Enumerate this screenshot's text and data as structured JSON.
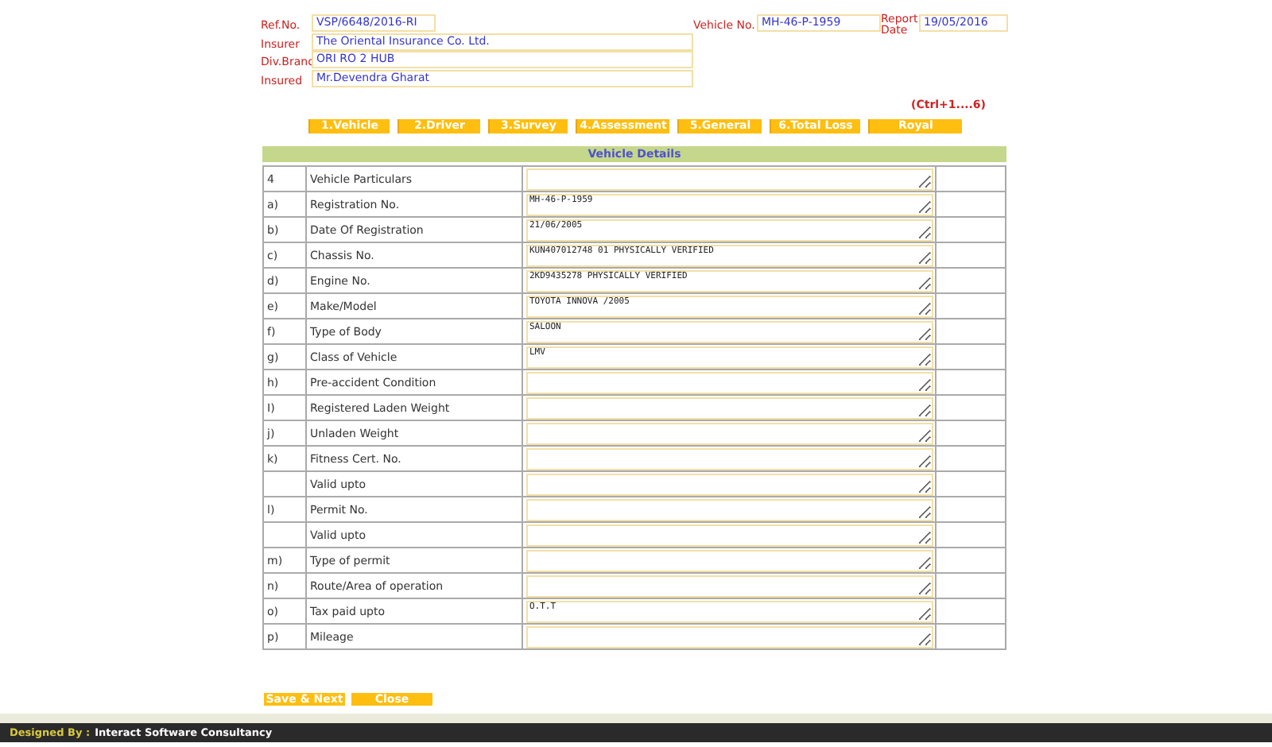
{
  "header": {
    "ref_no": {
      "label": "Ref.No.",
      "value": "VSP/6648/2016-RI"
    },
    "insurer": {
      "label": "Insurer",
      "value": "The Oriental Insurance Co. Ltd."
    },
    "div_branch": {
      "label": "Div.Branc",
      "value": "ORI RO 2 HUB"
    },
    "insured": {
      "label": "Insured",
      "value": "Mr.Devendra Gharat"
    },
    "vehicle_no": {
      "label": "Vehicle No.",
      "value": "MH-46-P-1959"
    },
    "report_date": {
      "label": "Report Date",
      "value": "19/05/2016"
    }
  },
  "shortcut_hint": "(Ctrl+1....6)",
  "tabs": [
    "1.Vehicle",
    "2.Driver",
    "3.Survey",
    "4.Assessment",
    "5.General",
    "6.Total Loss",
    "Royal"
  ],
  "section_title": "Vehicle Details",
  "rows": [
    {
      "index": "4",
      "label": "Vehicle Particulars"
    },
    {
      "index": "a)",
      "label": "Registration No.",
      "value": "MH-46-P-1959"
    },
    {
      "index": "b)",
      "label": "Date Of Registration",
      "value": "21/06/2005"
    },
    {
      "index": "c)",
      "label": "Chassis No.",
      "value": "KUN407012748 01 PHYSICALLY VERIFIED"
    },
    {
      "index": "d)",
      "label": "Engine No.",
      "value": "2KD9435278 PHYSICALLY VERIFIED"
    },
    {
      "index": "e)",
      "label": "Make/Model",
      "value": "TOYOTA INNOVA /2005"
    },
    {
      "index": "f)",
      "label": "Type of Body",
      "value": "SALOON"
    },
    {
      "index": "g)",
      "label": "Class of Vehicle",
      "value": "LMV"
    },
    {
      "index": "h)",
      "label": "Pre-accident Condition"
    },
    {
      "index": "I)",
      "label": "Registered Laden Weight"
    },
    {
      "index": "j)",
      "label": "Unladen Weight"
    },
    {
      "index": "k)",
      "label": "Fitness Cert. No."
    },
    {
      "label": "Valid upto"
    },
    {
      "index": "l)",
      "label": "Permit No."
    },
    {
      "label": "Valid upto"
    },
    {
      "index": "m)",
      "label": "Type of permit"
    },
    {
      "index": "n)",
      "label": "Route/Area of operation"
    },
    {
      "index": "o)",
      "label": "Tax paid upto",
      "value": "O.T.T"
    },
    {
      "index": "p)",
      "label": "Mileage"
    }
  ],
  "buttons": [
    "Save & Next",
    "Close"
  ],
  "footer": {
    "prefix": "Designed By :",
    "text": "Interact Software Consultancy"
  }
}
